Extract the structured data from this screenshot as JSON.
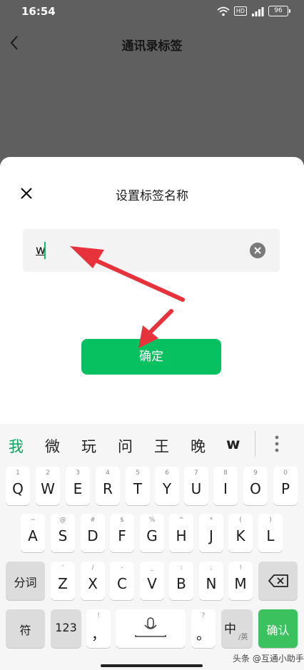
{
  "status": {
    "time": "16:54",
    "hd": "HD",
    "battery": "96"
  },
  "nav": {
    "title": "通讯录标签"
  },
  "dialog": {
    "title": "设置标签名称",
    "input_value": "w",
    "confirm_label": "确定"
  },
  "keyboard": {
    "candidates": [
      "我",
      "微",
      "玩",
      "问",
      "王",
      "晚",
      "w"
    ],
    "row1": [
      {
        "main": "Q",
        "sub": "1"
      },
      {
        "main": "W",
        "sub": "2"
      },
      {
        "main": "E",
        "sub": "3"
      },
      {
        "main": "R",
        "sub": "4"
      },
      {
        "main": "T",
        "sub": "5"
      },
      {
        "main": "Y",
        "sub": "6"
      },
      {
        "main": "U",
        "sub": "7"
      },
      {
        "main": "I",
        "sub": "8"
      },
      {
        "main": "O",
        "sub": "9"
      },
      {
        "main": "P",
        "sub": "0"
      }
    ],
    "row2": [
      {
        "main": "A",
        "sub": "~"
      },
      {
        "main": "S",
        "sub": "@"
      },
      {
        "main": "D",
        "sub": "#"
      },
      {
        "main": "F",
        "sub": "$"
      },
      {
        "main": "G",
        "sub": "%"
      },
      {
        "main": "H",
        "sub": "^"
      },
      {
        "main": "J",
        "sub": "*"
      },
      {
        "main": "K",
        "sub": "("
      },
      {
        "main": "L",
        "sub": ")"
      }
    ],
    "row3": [
      {
        "main": "Z",
        "sub": "'"
      },
      {
        "main": "X",
        "sub": "/"
      },
      {
        "main": "C",
        "sub": "-"
      },
      {
        "main": "V",
        "sub": "_"
      },
      {
        "main": "B",
        "sub": ":"
      },
      {
        "main": "N",
        "sub": ";"
      },
      {
        "main": "M",
        "sub": "!"
      }
    ],
    "fenci_label": "分词",
    "fu_label": "符",
    "num_label": "123",
    "comma_main": "，",
    "comma_sub": "!",
    "period_main": "。",
    "period_sub": "?",
    "lang_main": "中",
    "lang_sub": "/英",
    "enter_label": "确认"
  },
  "watermark": "头条 @互通小助手"
}
